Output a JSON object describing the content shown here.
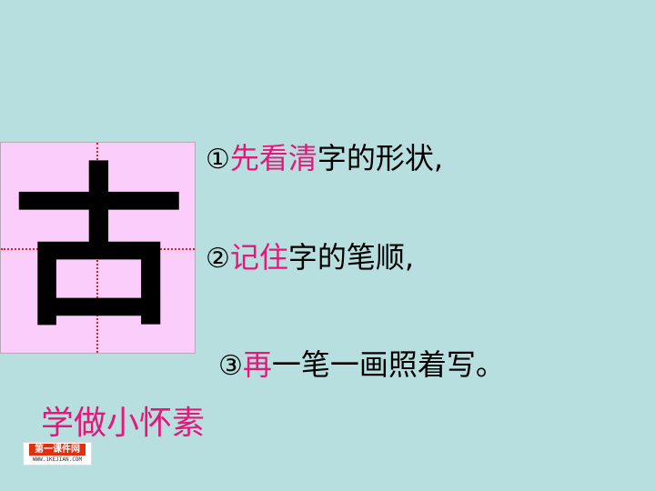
{
  "character": "古",
  "steps": [
    {
      "num": "①",
      "highlight": "先看清",
      "rest": "字的形状,"
    },
    {
      "num": "②",
      "highlight": "记住",
      "rest": "字的笔顺,"
    },
    {
      "num": "③",
      "highlight": "再",
      "rest": "一笔一画照着写。"
    }
  ],
  "heading": "学做小怀素",
  "logo": {
    "name": "第一课件网",
    "url": "WWW.1KEJIAN.COM"
  },
  "colors": {
    "background": "#b7dfe0",
    "box": "#fbcdfb",
    "accent": "#e6177a",
    "guides": "#e0201e"
  }
}
